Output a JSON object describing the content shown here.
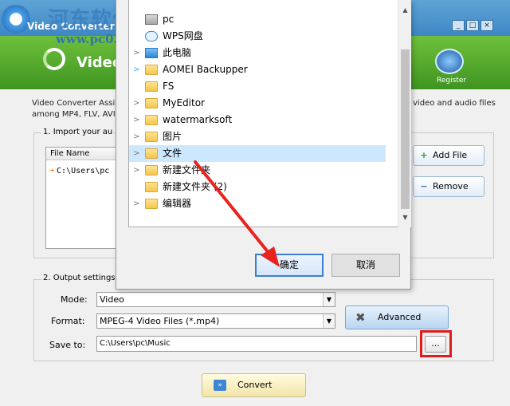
{
  "app": {
    "title": "Video Converter",
    "header_title": "Video C",
    "register_label": "Register",
    "description_left": [
      "Video Converter Assis",
      "among MP4, FLV, AVI"
    ],
    "description_right": "video and audio files"
  },
  "watermark": {
    "brand": "河东软件园",
    "url": "www.pc0359.cn"
  },
  "import": {
    "label": "1. Import your au",
    "column_header": "File Name",
    "rows": [
      {
        "path": "C:\\Users\\pc"
      }
    ],
    "add_file_label": "Add File",
    "remove_label": "Remove"
  },
  "output": {
    "label": "2. Output settings",
    "mode_label": "Mode:",
    "mode_value": "Video",
    "format_label": "Format:",
    "format_value": "MPEG-4 Video Files (*.mp4)",
    "saveto_label": "Save to:",
    "saveto_value": "C:\\Users\\pc\\Music",
    "advanced_label": "Advanced",
    "browse_label": "...",
    "convert_label": "Convert"
  },
  "dialog": {
    "items": [
      {
        "name": "pc",
        "icon": "drive-icon",
        "chevron": ""
      },
      {
        "name": "WPS网盘",
        "icon": "cloud-icon",
        "chevron": ""
      },
      {
        "name": "此电脑",
        "icon": "computer-icon",
        "chevron": ">"
      },
      {
        "name": "AOMEI Backupper",
        "icon": "folder-icon",
        "chevron": ">"
      },
      {
        "name": "FS",
        "icon": "folder-icon",
        "chevron": ""
      },
      {
        "name": "MyEditor",
        "icon": "folder-icon",
        "chevron": ">"
      },
      {
        "name": "watermarksoft",
        "icon": "folder-icon",
        "chevron": ">"
      },
      {
        "name": "图片",
        "icon": "folder-icon",
        "chevron": ">"
      },
      {
        "name": "文件",
        "icon": "folder-icon",
        "chevron": ">"
      },
      {
        "name": "新建文件夹",
        "icon": "folder-icon",
        "chevron": ">"
      },
      {
        "name": "新建文件夹 (2)",
        "icon": "folder-icon",
        "chevron": ""
      },
      {
        "name": "编辑器",
        "icon": "folder-icon",
        "chevron": ">"
      }
    ],
    "selected_index": 8,
    "ok_label": "确定",
    "cancel_label": "取消"
  },
  "colors": {
    "header_green": "#4fa82c",
    "titlebar_blue": "#4a93cc",
    "selection": "#cce8ff",
    "highlight_red": "#e01b1b"
  }
}
